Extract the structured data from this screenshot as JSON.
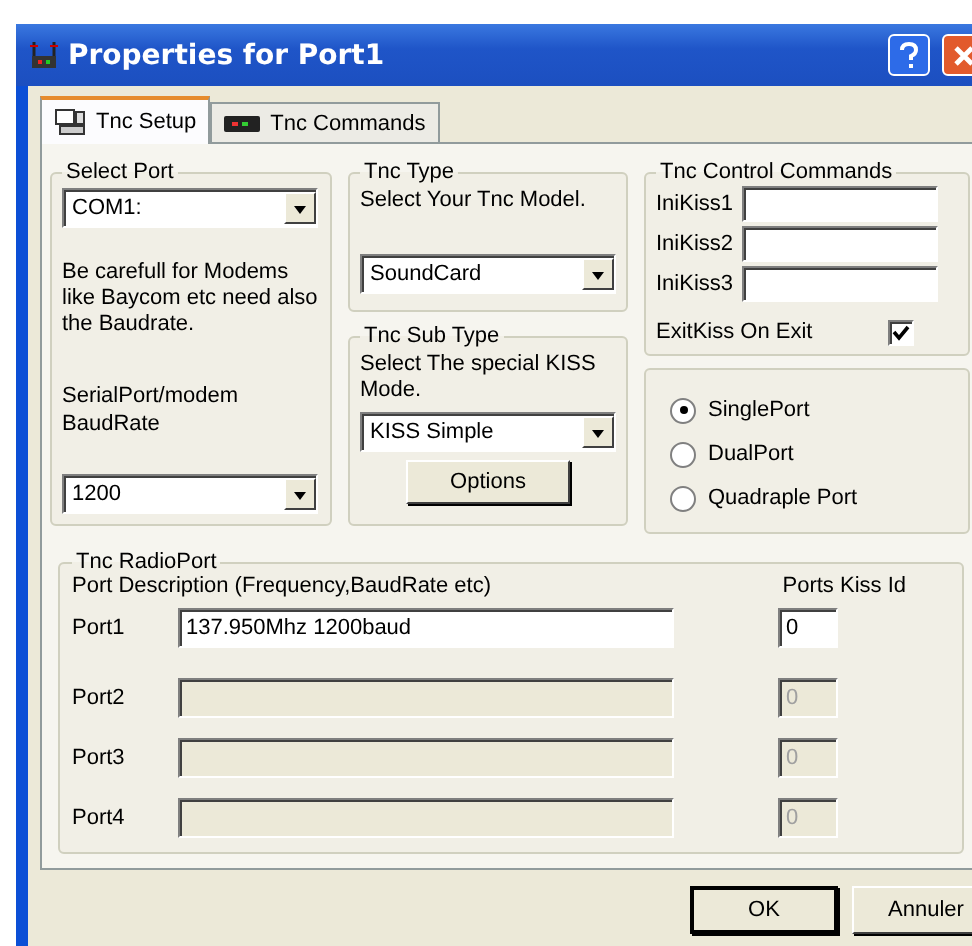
{
  "window": {
    "title": "Properties for Port1"
  },
  "tabs": [
    {
      "label": "Tnc Setup",
      "selected": true,
      "kind": "setup"
    },
    {
      "label": "Tnc Commands",
      "selected": false,
      "kind": "commands"
    }
  ],
  "select_port": {
    "title": "Select Port",
    "port": "COM1:",
    "note": "Be carefull for Modems like Baycom etc need also the Baudrate.",
    "baud_label": "SerialPort/modem BaudRate",
    "baud": "1200"
  },
  "tnc_type": {
    "title": "Tnc Type",
    "hint": "Select Your Tnc Model.",
    "value": "SoundCard"
  },
  "tnc_sub_type": {
    "title": "Tnc Sub Type",
    "hint": "Select The special KISS Mode.",
    "value": "KISS Simple",
    "button": "Options"
  },
  "control_commands": {
    "title": "Tnc Control Commands",
    "fields": [
      {
        "label": "IniKiss1"
      },
      {
        "label": "IniKiss2"
      },
      {
        "label": "IniKiss3"
      }
    ],
    "exit_kiss": {
      "label": "ExitKiss On Exit",
      "checked": true
    }
  },
  "port_mode": [
    {
      "label": "SinglePort",
      "selected": true
    },
    {
      "label": "DualPort",
      "selected": false
    },
    {
      "label": "Quadraple Port",
      "selected": false
    }
  ],
  "radio_port": {
    "title": "Tnc RadioPort",
    "description_header": "Port Description (Frequency,BaudRate etc)",
    "kiss_header": "Ports Kiss Id",
    "ports": [
      {
        "label": "Port1",
        "description": "137.950Mhz 1200baud",
        "kiss_id": "0",
        "disabled": false
      },
      {
        "label": "Port2",
        "kiss_id": "0",
        "disabled": true
      },
      {
        "label": "Port3",
        "kiss_id": "0",
        "disabled": true
      },
      {
        "label": "Port4",
        "kiss_id": "0",
        "disabled": true
      }
    ]
  },
  "buttons": [
    {
      "label": "OK",
      "default": true
    },
    {
      "label": "Annuler",
      "default": false
    }
  ]
}
